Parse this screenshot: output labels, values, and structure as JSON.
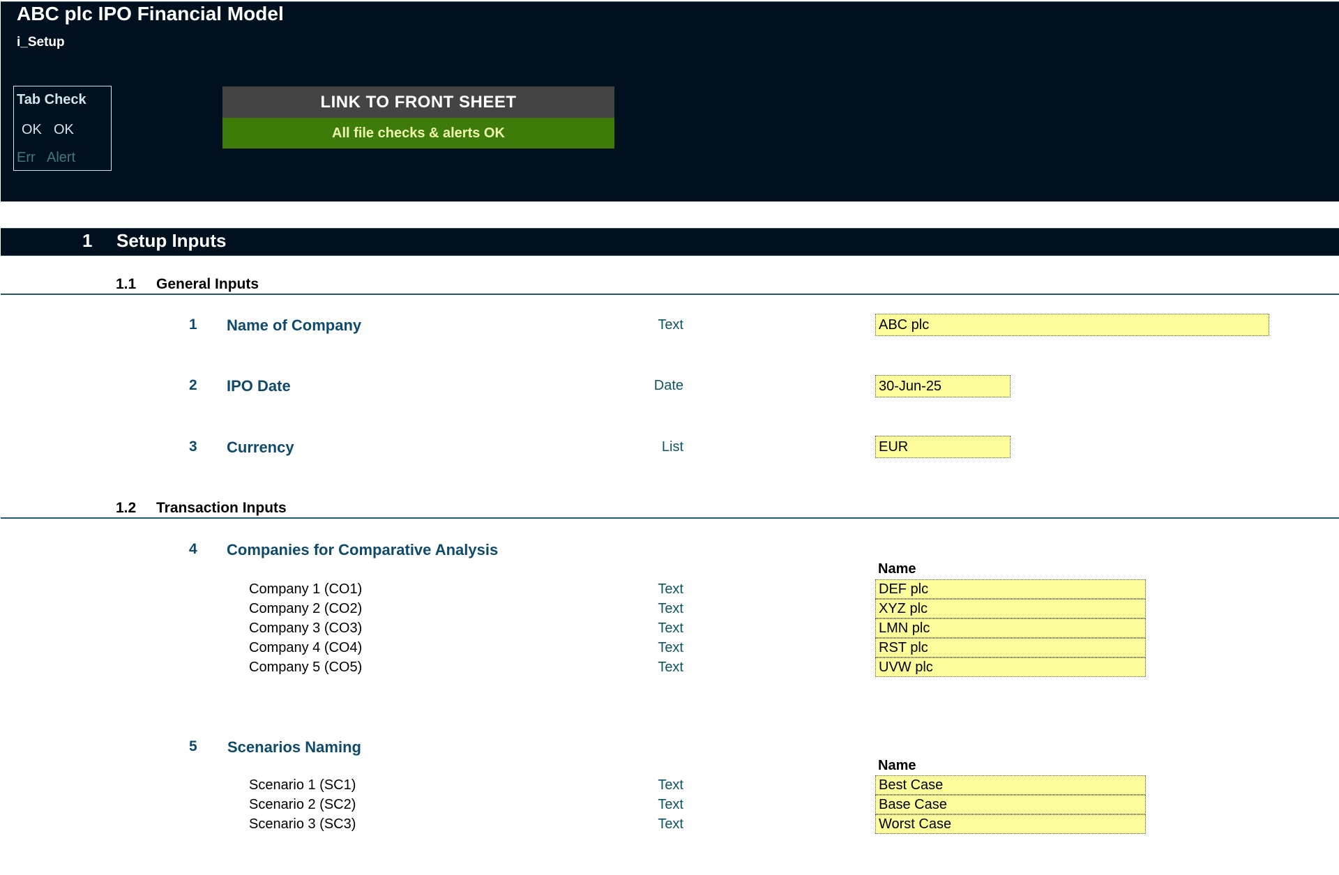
{
  "header": {
    "title": "ABC plc IPO Financial Model",
    "sheet_name": "i_Setup",
    "tab_check": {
      "title": "Tab Check",
      "ok_1": "OK",
      "ok_2": "OK",
      "err": "Err",
      "alert": "Alert"
    },
    "link_button": "LINK TO FRONT SHEET",
    "status_banner": "All file checks & alerts OK",
    "colors": {
      "banner": "#00101f",
      "link_bg": "#444444",
      "status_bg": "#3e7c0a",
      "input_bg": "#fdfd9b"
    }
  },
  "section": {
    "number": "1",
    "title": "Setup Inputs",
    "subsections": [
      {
        "number": "1.1",
        "title": "General Inputs",
        "items": [
          {
            "number": "1",
            "label": "Name of Company",
            "type": "Text",
            "value": "ABC plc"
          },
          {
            "number": "2",
            "label": "IPO Date",
            "type": "Date",
            "value": "30-Jun-25"
          },
          {
            "number": "3",
            "label": "Currency",
            "type": "List",
            "value": "EUR"
          }
        ]
      },
      {
        "number": "1.2",
        "title": "Transaction Inputs",
        "items": [
          {
            "number": "4",
            "label": "Companies  for Comparative Analysis",
            "column_header": "Name",
            "rows": [
              {
                "label": "Company 1 (CO1)",
                "type": "Text",
                "value": "DEF plc"
              },
              {
                "label": "Company 2 (CO2)",
                "type": "Text",
                "value": "XYZ plc"
              },
              {
                "label": "Company 3 (CO3)",
                "type": "Text",
                "value": "LMN plc"
              },
              {
                "label": "Company 4 (CO4)",
                "type": "Text",
                "value": "RST plc"
              },
              {
                "label": "Company 5 (CO5)",
                "type": "Text",
                "value": "UVW plc"
              }
            ]
          },
          {
            "number": "5",
            "label": "Scenarios Naming",
            "column_header": "Name",
            "rows": [
              {
                "label": "Scenario 1 (SC1)",
                "type": "Text",
                "value": "Best Case"
              },
              {
                "label": "Scenario 2 (SC2)",
                "type": "Text",
                "value": "Base Case"
              },
              {
                "label": "Scenario 3 (SC3)",
                "type": "Text",
                "value": "Worst Case"
              }
            ]
          }
        ]
      }
    ]
  }
}
